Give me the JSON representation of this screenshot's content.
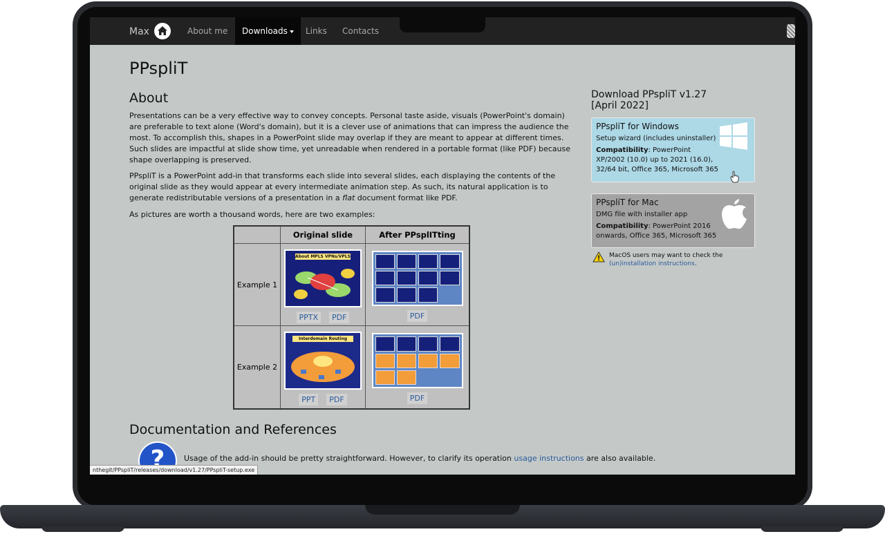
{
  "nav": {
    "brand": "Max",
    "items": [
      {
        "label": "About me"
      },
      {
        "label": "Downloads"
      },
      {
        "label": "Links"
      },
      {
        "label": "Contacts"
      }
    ]
  },
  "page": {
    "title": "PPspliT",
    "about_heading": "About",
    "paragraphs": [
      "Presentations can be a very effective way to convey concepts. Personal taste aside, visuals (PowerPoint's domain) are preferable to text alone (Word's domain), but it is a clever use of animations that can impress the audience the most. To accomplish this, shapes in a PowerPoint slide may overlap if they are meant to appear at different times. Such slides are impactful at slide show time, yet unreadable when rendered in a portable format (like PDF) because shape overlapping is preserved.",
      "PPspliT is a PowerPoint add-in that transforms each slide into several slides, each displaying the contents of the original slide as they would appear at every intermediate animation step. As such, its natural application is to generate redistributable versions of a presentation in a",
      "flat",
      "document format like PDF.",
      "As pictures are worth a thousand words, here are two examples:"
    ],
    "docs_heading": "Documentation and References",
    "docs_text_before": "Usage of the add-in should be pretty straightforward. However, to clarify its operation",
    "docs_link": "usage instructions",
    "docs_text_after": "are also available."
  },
  "examples_table": {
    "headers": [
      "",
      "Original slide",
      "After PPsplITting"
    ],
    "rows": [
      {
        "label": "Example 1",
        "original_title": "About MPLS VPNs/VPLS",
        "original_links": [
          "PPTX",
          "PDF"
        ],
        "after_links": [
          "PDF"
        ]
      },
      {
        "label": "Example 2",
        "original_title": "Interdomain Routing",
        "original_links": [
          "PPT",
          "PDF"
        ],
        "after_links": [
          "PDF"
        ]
      }
    ]
  },
  "sidebar": {
    "title_line1": "Download PPspliT v1.27",
    "title_line2": "[April 2022]",
    "windows": {
      "title": "PPspliT for Windows",
      "subtitle": "Setup wizard (includes uninstaller)",
      "compat_label": "Compatibility",
      "compat_text": ": PowerPoint XP/2002 (10.0) up to 2021 (16.0), 32/64 bit, Office 365, Microsoft 365"
    },
    "mac": {
      "title": "PPspliT for Mac",
      "subtitle": "DMG file with installer app",
      "compat_label": "Compatibility",
      "compat_text": ": PowerPoint 2016 onwards, Office 365, Microsoft 365"
    },
    "mac_note_before": "MacOS users may want to check the",
    "mac_note_link": "(un)installation instructions",
    "mac_note_after": "."
  },
  "status_bar": "nthegit/PPspliT/releases/download/v1.27/PPspliT-setup.exe",
  "colors": {
    "page_bg": "#c4c9c8",
    "navbar_bg": "#222222",
    "windows_box": "#add8e6",
    "mac_box": "#a3a3a3",
    "link": "#2a5a9a"
  }
}
